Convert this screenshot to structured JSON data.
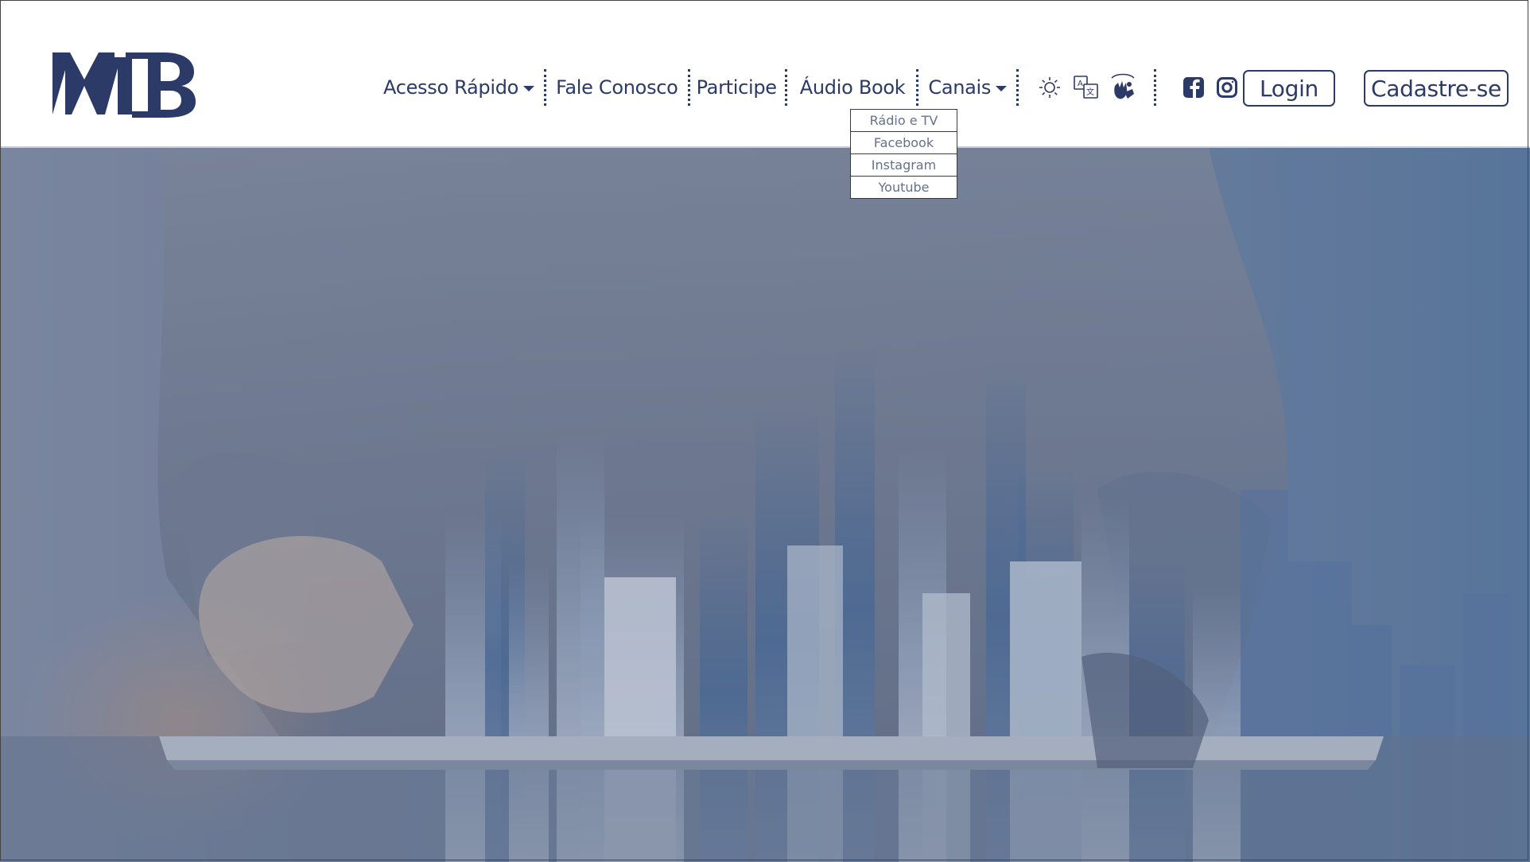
{
  "brand": {
    "logo_text": "MTB",
    "color": "#2b3a67"
  },
  "nav": {
    "items": [
      {
        "label": "Acesso Rápido",
        "has_dropdown": true
      },
      {
        "label": "Fale Conosco"
      },
      {
        "label": "Participe"
      },
      {
        "label": "Áudio Book"
      },
      {
        "label": "Canais",
        "has_dropdown": true,
        "expanded": true
      }
    ],
    "tool_icons": [
      "brightness-icon",
      "translate-icon",
      "sign-language-icon"
    ],
    "social_icons": [
      "facebook-icon",
      "instagram-icon",
      "whatsapp-icon"
    ]
  },
  "canais_menu": {
    "items": [
      "Rádio e TV",
      "Facebook",
      "Instagram",
      "Youtube"
    ]
  },
  "auth": {
    "login_label": "Login",
    "signup_label": "Cadastre-se"
  },
  "hero": {
    "image": "hand holding tablet with city skyline, blue overlay"
  }
}
